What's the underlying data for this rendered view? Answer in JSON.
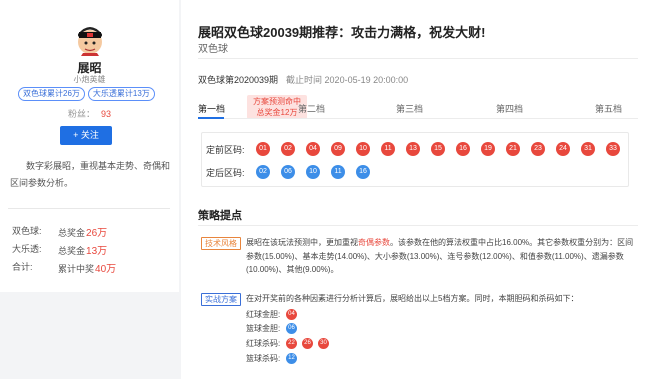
{
  "profile": {
    "name": "展昭",
    "subtitle": "小炮英雄",
    "tags": [
      "双色球累计26万",
      "大乐透累计13万"
    ],
    "fans_label": "粉丝：",
    "fans_count": "93",
    "follow_label": "+ 关注",
    "intro": "数字彩展昭，重视基本走势、奇偶和区间参数分析。",
    "stats": [
      {
        "key": "双色球:",
        "label": "总奖金",
        "value": "26万"
      },
      {
        "key": "大乐透:",
        "label": "总奖金",
        "value": "13万"
      },
      {
        "key": "合计:",
        "label": "累计中奖",
        "value": "40万"
      }
    ]
  },
  "article": {
    "title": "展昭双色球20039期推荐：攻击力满格，祝发大财!",
    "category": "双色球",
    "issue": "双色球第2020039期",
    "deadline": "截止时间 2020-05-19 20:00:00"
  },
  "tabs": [
    "第一档",
    "第二档",
    "第三档",
    "第四档",
    "第五档"
  ],
  "tip": {
    "line1": "方案预测命中",
    "line2": "总奖金12万"
  },
  "balls": {
    "front_label": "定前区码:",
    "front": [
      "01",
      "02",
      "04",
      "09",
      "10",
      "11",
      "13",
      "15",
      "16",
      "19",
      "21",
      "23",
      "24",
      "31",
      "33"
    ],
    "back_label": "定后区码:",
    "back": [
      "02",
      "06",
      "10",
      "11",
      "16"
    ]
  },
  "strategy": {
    "title": "策略提点",
    "tech_label": "技术风格",
    "tech_text_pre": "展昭在该玩法预测中，更加重视",
    "tech_highlight": "奇偶参数",
    "tech_text_post": "。该参数在他的算法权重中占比16.00%。其它参数权重分别为：区间参数(15.00%)、基本走势(14.00%)、大小参数(13.00%)、连号参数(12.00%)、和值参数(11.00%)、遗漏参数(10.00%)、其他(9.00%)。",
    "plan_label": "实战方案",
    "plan_text": "在对开奖前的各种因素进行分析计算后，展昭给出以上5档方案。同时，本期胆码和杀码如下：",
    "rows": [
      {
        "label": "红球金胆:",
        "balls": [
          "04"
        ],
        "color": "red"
      },
      {
        "label": "篮球金胆:",
        "balls": [
          "06"
        ],
        "color": "blue"
      },
      {
        "label": "红球杀码:",
        "balls": [
          "22",
          "26",
          "30"
        ],
        "color": "red"
      },
      {
        "label": "篮球杀码:",
        "balls": [
          "12"
        ],
        "color": "blue"
      }
    ]
  },
  "colors": {
    "accent": "#1f6fe3",
    "red": "#e8483d",
    "blue": "#3d8ee8",
    "orange": "#e8853d"
  }
}
